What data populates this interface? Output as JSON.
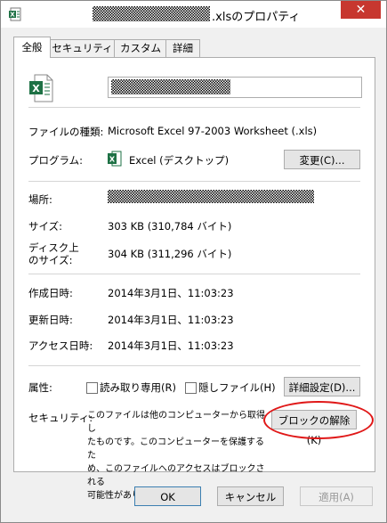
{
  "window": {
    "title_suffix": ".xlsのプロパティ",
    "close_label": "✕"
  },
  "tabs": [
    {
      "label": "全般",
      "active": true
    },
    {
      "label": "セキュリティ"
    },
    {
      "label": "カスタム"
    },
    {
      "label": "詳細"
    }
  ],
  "general": {
    "file_type_label": "ファイルの種類:",
    "file_type_value": "Microsoft Excel 97-2003 Worksheet (.xls)",
    "program_label": "プログラム:",
    "program_value": "Excel (デスクトップ)",
    "change_button": "変更(C)...",
    "location_label": "場所:",
    "size_label": "サイズ:",
    "size_value": "303 KB (310,784 バイト)",
    "disk_size_label_1": "ディスク上",
    "disk_size_label_2": "のサイズ:",
    "disk_size_value": "304 KB (311,296 バイト)",
    "created_label": "作成日時:",
    "created_value": "2014年3月1日、11:03:23",
    "modified_label": "更新日時:",
    "modified_value": "2014年3月1日、11:03:23",
    "accessed_label": "アクセス日時:",
    "accessed_value": "2014年3月1日、11:03:23",
    "attributes_label": "属性:",
    "readonly_label": "読み取り専用(R)",
    "hidden_label": "隠しファイル(H)",
    "advanced_button": "詳細設定(D)...",
    "security_label": "セキュリティ:",
    "security_text_1": "このファイルは他のコンピューターから取得し",
    "security_text_2": "たものです。このコンピューターを保護するた",
    "security_text_3": "め、このファイルへのアクセスはブロックされる",
    "security_text_4": "可能性があります。",
    "unblock_button": "ブロックの解除(K)"
  },
  "footer": {
    "ok": "OK",
    "cancel": "キャンセル",
    "apply": "適用(A)"
  },
  "colors": {
    "excel_green": "#1e7145",
    "highlight_red": "#e01818",
    "close_red": "#c7372f"
  }
}
